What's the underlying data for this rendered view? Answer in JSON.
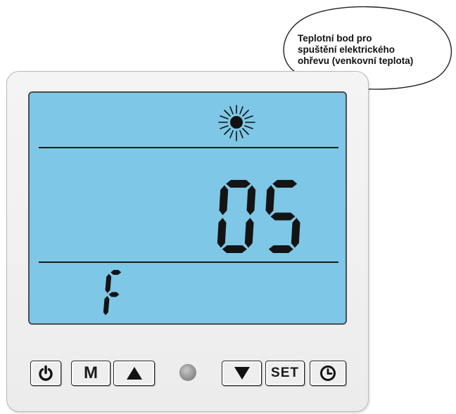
{
  "callout": {
    "lines": [
      "Teplotní bod pro",
      "spuštění elektrického",
      "ohřevu (venkovní teplota)"
    ]
  },
  "display": {
    "main_value": "05",
    "param_code": "F",
    "mode_icon": "sun-icon",
    "backlight_color": "#7ec7e6"
  },
  "buttons": [
    {
      "id": "power",
      "label": "",
      "icon": "power-icon"
    },
    {
      "id": "mode",
      "label": "M",
      "icon": ""
    },
    {
      "id": "up",
      "label": "",
      "icon": "triangle-up-icon"
    },
    {
      "id": "down",
      "label": "",
      "icon": "triangle-down-icon"
    },
    {
      "id": "set",
      "label": "SET",
      "icon": ""
    },
    {
      "id": "clock",
      "label": "",
      "icon": "clock-icon"
    }
  ],
  "indicator_led": {
    "state": "off"
  }
}
